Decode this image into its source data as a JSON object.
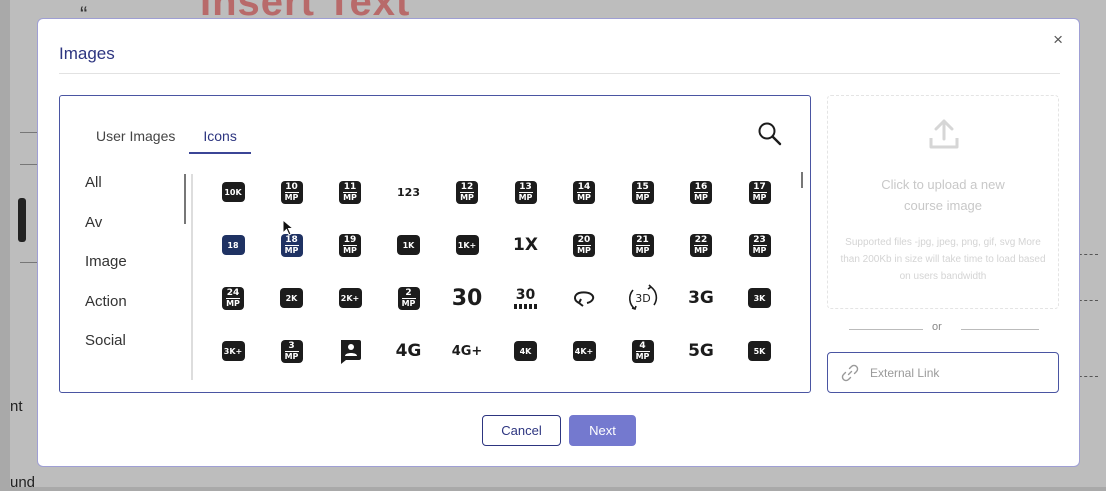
{
  "background": {
    "heading": "Insert Text",
    "quote_mark": "“",
    "text_nt": "nt",
    "text_und": "und"
  },
  "modal": {
    "title": "Images",
    "close_glyph": "×"
  },
  "tabs": [
    {
      "label": "User Images",
      "active": false
    },
    {
      "label": "Icons",
      "active": true
    }
  ],
  "categories": [
    "All",
    "Av",
    "Image",
    "Action",
    "Social"
  ],
  "icon_rows": [
    [
      {
        "name": "10k-icon",
        "kind": "sm",
        "text": "10K"
      },
      {
        "name": "10mp-icon",
        "kind": "mp",
        "text": "10"
      },
      {
        "name": "11mp-icon",
        "kind": "mp",
        "text": "11"
      },
      {
        "name": "123-icon",
        "kind": "txt",
        "text": "123"
      },
      {
        "name": "12mp-icon",
        "kind": "mp",
        "text": "12"
      },
      {
        "name": "13mp-icon",
        "kind": "mp",
        "text": "13"
      },
      {
        "name": "14mp-icon",
        "kind": "mp",
        "text": "14"
      },
      {
        "name": "15mp-icon",
        "kind": "mp",
        "text": "15"
      },
      {
        "name": "16mp-icon",
        "kind": "mp",
        "text": "16"
      },
      {
        "name": "17mp-icon",
        "kind": "mp",
        "text": "17"
      }
    ],
    [
      {
        "name": "18-up-rating-icon",
        "kind": "sm",
        "text": "18"
      },
      {
        "name": "18mp-icon",
        "kind": "mp",
        "text": "18"
      },
      {
        "name": "19mp-icon",
        "kind": "mp",
        "text": "19"
      },
      {
        "name": "1k-icon",
        "kind": "sm",
        "text": "1K"
      },
      {
        "name": "1k-plus-icon",
        "kind": "sm",
        "text": "1K+"
      },
      {
        "name": "1x-mobiledata-icon",
        "kind": "txt",
        "text": "1X"
      },
      {
        "name": "20mp-icon",
        "kind": "mp",
        "text": "20"
      },
      {
        "name": "21mp-icon",
        "kind": "mp",
        "text": "21"
      },
      {
        "name": "22mp-icon",
        "kind": "mp",
        "text": "22"
      },
      {
        "name": "23mp-icon",
        "kind": "mp",
        "text": "23"
      }
    ],
    [
      {
        "name": "24mp-icon",
        "kind": "mp",
        "text": "24"
      },
      {
        "name": "2k-icon",
        "kind": "sm",
        "text": "2K"
      },
      {
        "name": "2k-plus-icon",
        "kind": "sm",
        "text": "2K+"
      },
      {
        "name": "2mp-icon",
        "kind": "mp",
        "text": "2"
      },
      {
        "name": "30fps-icon",
        "kind": "big",
        "text": "30"
      },
      {
        "name": "30fps-select-icon",
        "kind": "fps",
        "text": "30"
      },
      {
        "name": "360-icon",
        "kind": "rot",
        "text": ""
      },
      {
        "name": "3d-rotation-icon",
        "kind": "rot3d",
        "text": "3D"
      },
      {
        "name": "3g-mobiledata-icon",
        "kind": "txt",
        "text": "3G"
      },
      {
        "name": "3k-icon",
        "kind": "sm",
        "text": "3K"
      }
    ],
    [
      {
        "name": "3k-plus-icon",
        "kind": "sm",
        "text": "3K+"
      },
      {
        "name": "3mp-icon",
        "kind": "mp",
        "text": "3"
      },
      {
        "name": "account-box-icon",
        "kind": "acct",
        "text": ""
      },
      {
        "name": "4g-mobiledata-icon",
        "kind": "txt",
        "text": "4G"
      },
      {
        "name": "4g-plus-mobiledata-icon",
        "kind": "txt",
        "text": "4G+"
      },
      {
        "name": "4k-icon",
        "kind": "sm",
        "text": "4K"
      },
      {
        "name": "4k-plus-icon",
        "kind": "sm",
        "text": "4K+"
      },
      {
        "name": "4mp-icon",
        "kind": "mp",
        "text": "4"
      },
      {
        "name": "5g-icon",
        "kind": "txt",
        "text": "5G"
      },
      {
        "name": "5k-icon",
        "kind": "sm",
        "text": "5K"
      }
    ]
  ],
  "icon_sublabel": "MP",
  "upload": {
    "main_text": "Click to upload a new course image",
    "hint_text": "Supported files -jpg, jpeg, png, gif, svg More than 200Kb in size will take time to load based on users bandwidth"
  },
  "or_text": "or",
  "external_link": {
    "label": "External Link"
  },
  "buttons": {
    "cancel": "Cancel",
    "next": "Next"
  },
  "colors": {
    "accent": "#2d3580",
    "next_button": "#7479cf",
    "panel_border": "#4a55a2"
  }
}
